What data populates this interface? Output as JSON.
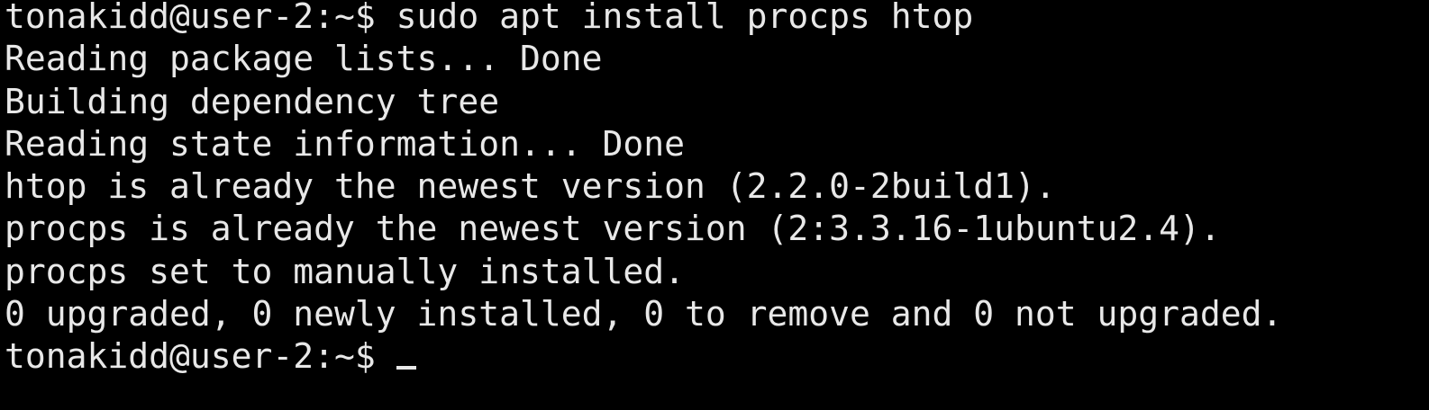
{
  "terminal": {
    "lines": [
      "tonakidd@user-2:~$ sudo apt install procps htop",
      "Reading package lists... Done",
      "Building dependency tree",
      "Reading state information... Done",
      "htop is already the newest version (2.2.0-2build1).",
      "procps is already the newest version (2:3.3.16-1ubuntu2.4).",
      "procps set to manually installed.",
      "0 upgraded, 0 newly installed, 0 to remove and 0 not upgraded."
    ],
    "prompt": "tonakidd@user-2:~$ "
  },
  "colors": {
    "background": "#000000",
    "foreground": "#e8e8e8"
  }
}
